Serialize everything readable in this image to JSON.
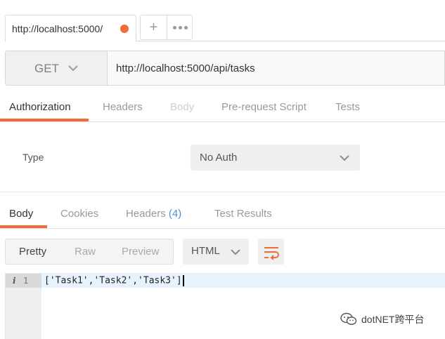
{
  "tabs": {
    "active_label": "http://localhost:5000/",
    "unsaved_color": "#f26b3a",
    "add_icon": "plus-icon",
    "more_icon": "more-dots-icon"
  },
  "request": {
    "method": "GET",
    "url": "http://localhost:5000/api/tasks"
  },
  "request_tabs": [
    {
      "label": "Authorization"
    },
    {
      "label": "Headers"
    },
    {
      "label": "Body"
    },
    {
      "label": "Pre-request Script"
    },
    {
      "label": "Tests"
    }
  ],
  "auth": {
    "type_label": "Type",
    "type_value": "No Auth"
  },
  "response_tabs": {
    "body": "Body",
    "cookies": "Cookies",
    "headers": "Headers",
    "headers_count": "(4)",
    "test_results": "Test Results"
  },
  "response_toolbar": {
    "views": [
      "Pretty",
      "Raw",
      "Preview"
    ],
    "format": "HTML",
    "wrap_icon": "wrap-lines-icon"
  },
  "response_body": {
    "line_number": "1",
    "content": "['Task1','Task2','Task3']"
  },
  "watermark": {
    "text": "dotNET跨平台"
  },
  "colors": {
    "accent": "#f26b3a",
    "link": "#4a90d9"
  }
}
